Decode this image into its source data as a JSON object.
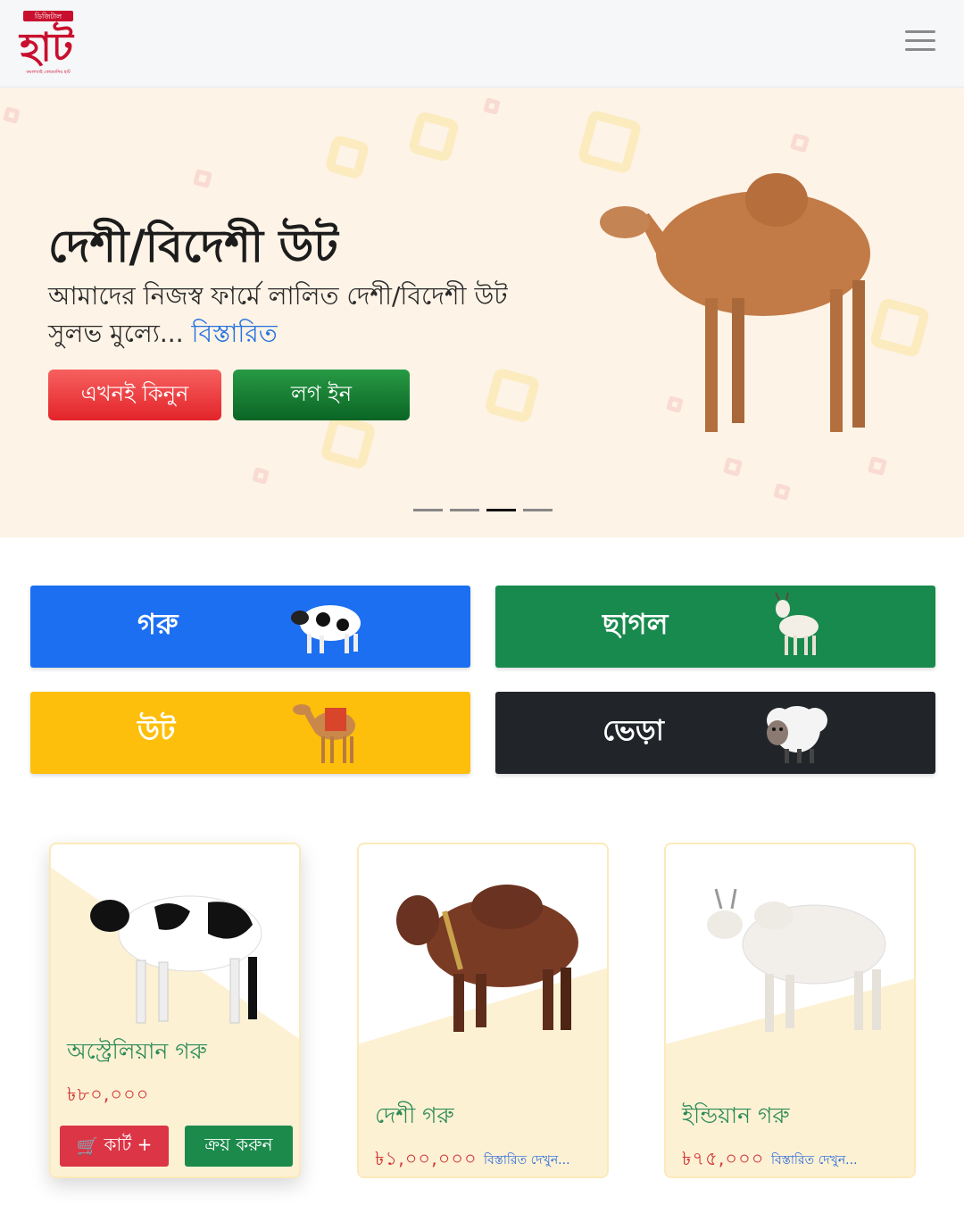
{
  "brand": {
    "logo_text": "হাট",
    "logo_top": "ডিজিটাল",
    "logo_tagline": "কমলাবাই কোরবানির হাট"
  },
  "hero": {
    "title": "দেশী/বিদেশী উট",
    "subtitle": "আমাদের নিজস্ব ফার্মে লালিত দেশী/বিদেশী উট সুলভ মুল্যে...",
    "details_link": "বিস্তারিত",
    "buy_now": "এখনই কিনুন",
    "login": "লগ ইন",
    "slides": 4,
    "active_slide": 3
  },
  "categories": [
    {
      "label": "গরু",
      "icon": "cow-icon",
      "color": "#1d6ff2"
    },
    {
      "label": "ছাগল",
      "icon": "goat-icon",
      "color": "#198a4e"
    },
    {
      "label": "উট",
      "icon": "camel-icon",
      "color": "#fdbf0c"
    },
    {
      "label": "ভেড়া",
      "icon": "sheep-icon",
      "color": "#212529"
    }
  ],
  "products": [
    {
      "name": "অস্ট্রেলিয়ান গরু",
      "price": "৳৮০,০০০",
      "cart": "কার্ট +",
      "buy": "ক্রয় করুন"
    },
    {
      "name": "দেশী গরু",
      "price": "৳১,০০,০০০",
      "details": "বিস্তারিত দেখুন..."
    },
    {
      "name": "ইন্ডিয়ান গরু",
      "price": "৳৭৫,০০০",
      "details": "বিস্তারিত দেখুন..."
    }
  ],
  "colors": {
    "accent_red": "#dc3545",
    "accent_green": "#1b8a4b",
    "link_blue": "#2a6ad8"
  }
}
